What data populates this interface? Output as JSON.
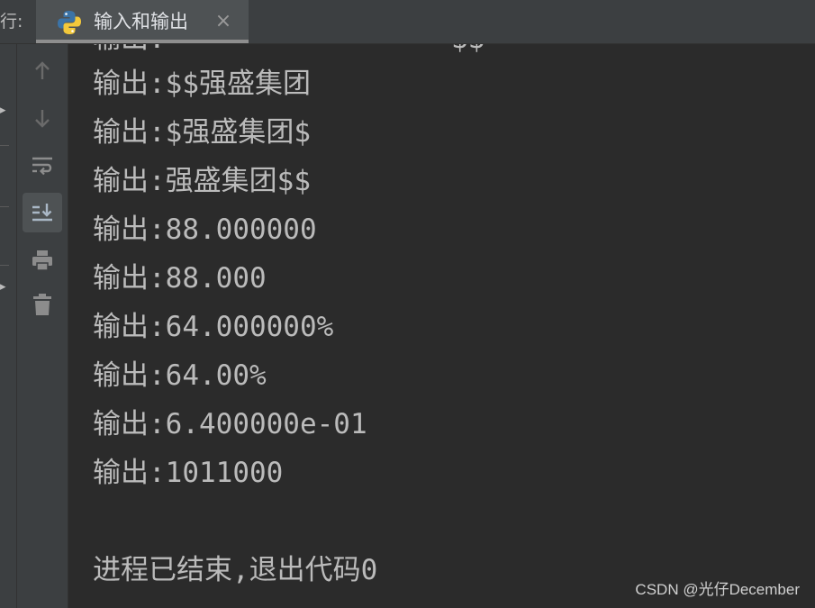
{
  "tabbar": {
    "run_label": "行:",
    "tab_title": "输入和输出",
    "tab_icon": "python-icon",
    "close_symbol": "×"
  },
  "toolbar": {
    "items": [
      "arrow-up-icon",
      "arrow-down-icon",
      "soft-wrap-icon",
      "scroll-to-end-icon",
      "print-icon",
      "trash-icon"
    ],
    "active": "scroll-to-end-icon"
  },
  "console": {
    "partial_top_line": "输出:                 $$",
    "lines": [
      "输出:$$强盛集团",
      "输出:$强盛集团$",
      "输出:强盛集团$$",
      "输出:88.000000",
      "输出:88.000",
      "输出:64.000000%",
      "输出:64.00%",
      "输出:6.400000e-01",
      "输出:1011000",
      "",
      "进程已结束,退出代码0"
    ]
  },
  "watermark": "CSDN @光仔December",
  "colors": {
    "background": "#2b2b2b",
    "panel": "#3c3f41",
    "text": "#bbbbbb",
    "icon": "#8c8c8c",
    "icon_dim": "#6a6a6a"
  }
}
